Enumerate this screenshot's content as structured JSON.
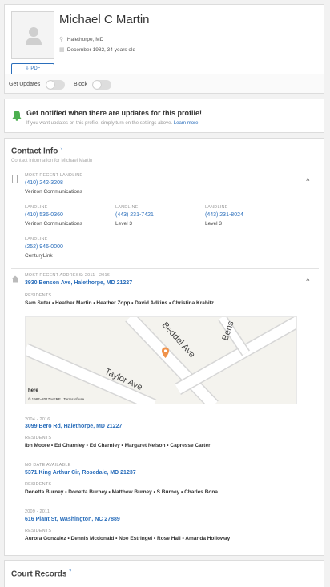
{
  "profile": {
    "name": "Michael C Martin",
    "location": "Halethorpe, MD",
    "dob": "December 1982, 34 years old",
    "pdf_label": "PDF"
  },
  "toggles": {
    "get_updates": "Get Updates",
    "block": "Block"
  },
  "notify": {
    "title": "Get notified when there are updates for this profile!",
    "subtitle": "If you want updates on this profile, simply turn on the settings above.",
    "learn_more": "Learn more."
  },
  "contact": {
    "title": "Contact Info",
    "title_mark": "?",
    "subtitle": "Contact information for Michael Martin",
    "phones": {
      "recent_label": "MOST RECENT LANDLINE",
      "recent_number": "(410) 242-3208",
      "recent_carrier": "Verizon Communications",
      "others": [
        {
          "label": "LANDLINE",
          "number": "(410) 536-0360",
          "carrier": "Verizon Communications"
        },
        {
          "label": "LANDLINE",
          "number": "(443) 231-7421",
          "carrier": "Level 3"
        },
        {
          "label": "LANDLINE",
          "number": "(443) 231-8024",
          "carrier": "Level 3"
        },
        {
          "label": "LANDLINE",
          "number": "(252) 946-0000",
          "carrier": "CenturyLink"
        }
      ]
    },
    "addresses": [
      {
        "label": "MOST RECENT ADDRESS: 2011 - 2016",
        "address": "3930 Benson Ave, Halethorpe, MD 21227",
        "residents_label": "RESIDENTS",
        "residents": "Sam Suter  •  Heather Martin  •  Heather Zopp  •  David Adkins  •  Christina Krabitz"
      },
      {
        "label": "2004 - 2016",
        "address": "3099 Bero Rd, Halethorpe, MD 21227",
        "residents_label": "RESIDENTS",
        "residents": "Ibn Moore  •  Ed Charnley  •  Ed Charnley  •  Margaret Nelson  •  Capresse Carter"
      },
      {
        "label": "NO DATE AVAILABLE",
        "address": "5371 King Arthur Cir, Rosedale, MD 21237",
        "residents_label": "RESIDENTS",
        "residents": "Donetta Burney  •  Donetta Burney  •  Matthew Burney  •  S Burney  •  Charles Bona"
      },
      {
        "label": "2009 - 2011",
        "address": "616 Plant St, Washington, NC 27889",
        "residents_label": "RESIDENTS",
        "residents": "Aurora Gonzalez  •  Dennis Mcdonald  •  Noe Estringel  •  Rose Hall  •  Amanda Holloway"
      }
    ],
    "map": {
      "street1": "Taylor Ave",
      "street2": "Beddel Ave",
      "street3": "Bens",
      "copyright": "© 1987–2017 HERE | Terms of use",
      "logo": "here"
    }
  },
  "court": {
    "title": "Court Records",
    "title_mark": "?"
  },
  "colors": {
    "link": "#2a6ebb",
    "bell": "#4caf50",
    "pin": "#f0924a"
  }
}
